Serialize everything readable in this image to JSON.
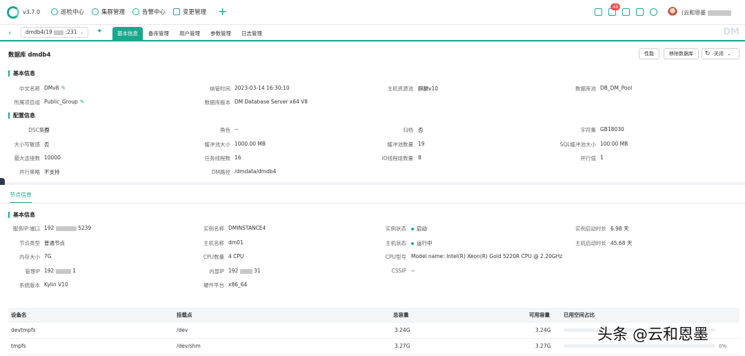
{
  "app": {
    "version": "v3.7.0",
    "accent": "#18a88e",
    "watermark": "头条 @云和恩墨"
  },
  "topnav": [
    {
      "label": "巡检中心",
      "icon": "inspect-icon"
    },
    {
      "label": "集群管理",
      "icon": "cluster-icon"
    },
    {
      "label": "告警中心",
      "icon": "alarm-icon"
    },
    {
      "label": "变更管理",
      "icon": "change-icon"
    }
  ],
  "toolbar": {
    "badge_count": "49",
    "username": "(云和恩墨"
  },
  "tabbar": {
    "db_select": "dmdb4(19",
    "db_select_suffix": ":231",
    "tabs": [
      "基本信息",
      "备库管理",
      "用户管理",
      "参数管理",
      "日志管理"
    ],
    "brand_mark": "DM"
  },
  "page": {
    "title": "数据库 dmdb4",
    "buttons": {
      "perf": "性能",
      "remove": "移除数据库",
      "close": "关闭"
    }
  },
  "basic": {
    "section": "基本信息",
    "fields": [
      {
        "label": "中文名称",
        "value": "DMv8",
        "edit": true
      },
      {
        "label": "纳管时间",
        "value": "2023-03-14 16:30:10"
      },
      {
        "label": "主机资源池",
        "value": "麒麟v10"
      },
      {
        "label": "数据库池",
        "value": "DB_DM_Pool"
      },
      {
        "label": "所属项目组",
        "value": "Public_Group",
        "edit": true
      },
      {
        "label": "数据库版本",
        "value": "DM Database Server x64 V8"
      }
    ]
  },
  "config": {
    "section": "配置信息",
    "fields": [
      {
        "label": "DSC集群",
        "value": "否"
      },
      {
        "label": "角色",
        "value": "--"
      },
      {
        "label": "归档",
        "value": "否"
      },
      {
        "label": "字符集",
        "value": "GB18030"
      },
      {
        "label": "大小写敏感",
        "value": "否"
      },
      {
        "label": "缓冲池大小",
        "value": "1000.00 MB"
      },
      {
        "label": "缓冲池数量",
        "value": "19"
      },
      {
        "label": "SQL缓冲池大小",
        "value": "100.00 MB"
      },
      {
        "label": "最大连接数",
        "value": "10000"
      },
      {
        "label": "任务线程数",
        "value": "16"
      },
      {
        "label": "IO线程组数量",
        "value": "8"
      },
      {
        "label": "并行值",
        "value": "1"
      },
      {
        "label": "并行策略",
        "value": "不支持"
      },
      {
        "label": "DM路径",
        "value": "/dmdata/dmdb4"
      }
    ]
  },
  "node": {
    "tab": "节点信息",
    "section": "基本信息",
    "fields": [
      {
        "label": "服务IP:端口",
        "value": "192",
        "value_suffix": "5239"
      },
      {
        "label": "实例名称",
        "value": "DMINSTANCE4"
      },
      {
        "label": "实例状态",
        "value": "启动",
        "status": true
      },
      {
        "label": "实例启动时长",
        "value": "6.98 天"
      },
      {
        "label": "节点类型",
        "value": "普通节点"
      },
      {
        "label": "主机名称",
        "value": "dm01"
      },
      {
        "label": "主机状态",
        "value": "运行中",
        "status": true
      },
      {
        "label": "主机启动时长",
        "value": "45.68 天"
      },
      {
        "label": "内存大小",
        "value": "7G"
      },
      {
        "label": "CPU数量",
        "value": "4 CPU"
      },
      {
        "label": "CPU型号",
        "value": "Model name: Intel(R) Xeon(R) Gold 5220R CPU @ 2.20GHz"
      },
      {
        "label": "管理IP",
        "value": "192",
        "value_suffix": "1"
      },
      {
        "label": "内部IP",
        "value": "192",
        "value_suffix": "31"
      },
      {
        "label": "CSSIP",
        "value": "--"
      },
      {
        "label": "系统版本",
        "value": "Kylin V10"
      },
      {
        "label": "硬件平台",
        "value": "x86_64"
      }
    ]
  },
  "disk_table": {
    "headers": [
      "设备名",
      "挂载点",
      "总容量",
      "可用容量",
      "已用空间占比"
    ],
    "rows": [
      {
        "device": "devtmpfs",
        "mount": "/dev",
        "total": "3.24G",
        "avail": "3.24G",
        "used_pct": 0
      },
      {
        "device": "tmpfs",
        "mount": "/dev/shm",
        "total": "3.27G",
        "avail": "3.27G",
        "used_pct": 0,
        "pct_label": "0%"
      }
    ]
  }
}
